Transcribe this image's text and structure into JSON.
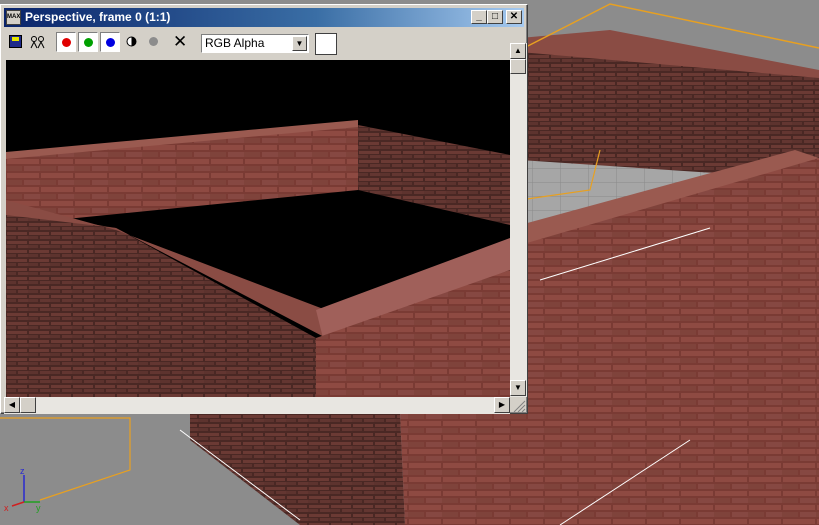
{
  "window": {
    "title": "Perspective, frame 0 (1:1)",
    "title_icon": "MAX",
    "buttons": {
      "minimize": "_",
      "maximize": "□",
      "close": "✕"
    }
  },
  "toolbar": {
    "channel_select": "RGB Alpha",
    "clear_glyph": "✕",
    "colors": {
      "red": "#e00000",
      "green": "#00a000",
      "blue": "#0000e0",
      "gray": "#8c8c8c"
    }
  },
  "scroll": {
    "up": "▲",
    "down": "▼",
    "left": "◀",
    "right": "▶"
  },
  "axis": {
    "x": "x",
    "y": "y",
    "z": "z"
  }
}
